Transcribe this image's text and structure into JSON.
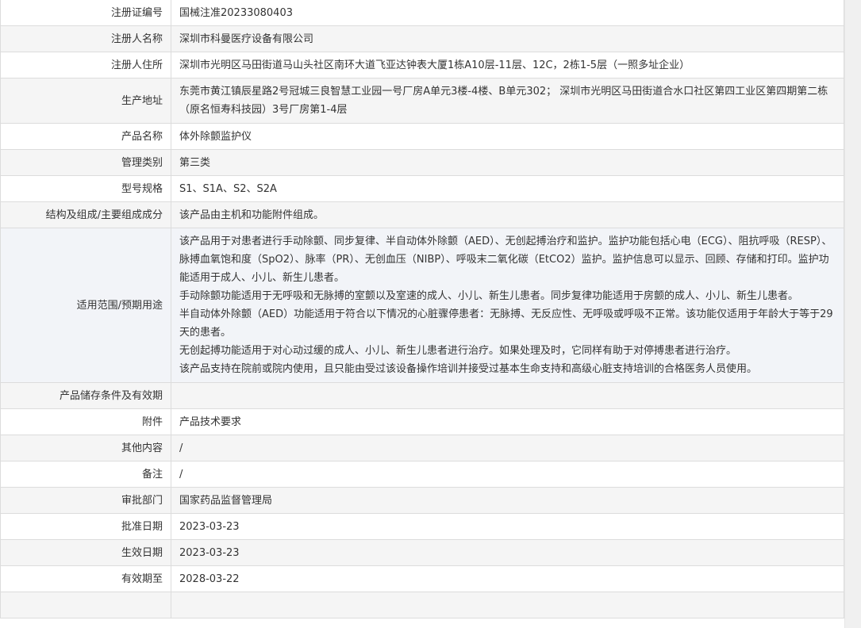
{
  "rows": [
    {
      "label": "注册证编号",
      "value": "国械注准20233080403"
    },
    {
      "label": "注册人名称",
      "value": "深圳市科曼医疗设备有限公司"
    },
    {
      "label": "注册人住所",
      "value": "深圳市光明区马田街道马山头社区南环大道飞亚达钟表大厦1栋A10层-11层、12C，2栋1-5层（一照多址企业）"
    },
    {
      "label": "生产地址",
      "value": "东莞市黄江镇辰星路2号冠城三良智慧工业园一号厂房A单元3楼-4楼、B单元302； 深圳市光明区马田街道合水口社区第四工业区第四期第二栋（原名恒寿科技园）3号厂房第1-4层"
    },
    {
      "label": "产品名称",
      "value": "体外除颤监护仪"
    },
    {
      "label": "管理类别",
      "value": "第三类"
    },
    {
      "label": "型号规格",
      "value": "S1、S1A、S2、S2A"
    },
    {
      "label": "结构及组成/主要组成成分",
      "value": "该产品由主机和功能附件组成。"
    },
    {
      "label": "适用范围/预期用途",
      "lines": [
        "该产品用于对患者进行手动除颤、同步复律、半自动体外除颤（AED）、无创起搏治疗和监护。监护功能包括心电（ECG）、阻抗呼吸（RESP）、脉搏血氧饱和度（SpO2）、脉率（PR）、无创血压（NIBP）、呼吸末二氧化碳（EtCO2）监护。监护信息可以显示、回顾、存储和打印。监护功能适用于成人、小儿、新生儿患者。",
        "手动除颤功能适用于无呼吸和无脉搏的室颤以及室速的成人、小儿、新生儿患者。同步复律功能适用于房颤的成人、小儿、新生儿患者。",
        "半自动体外除颤（AED）功能适用于符合以下情况的心脏骤停患者：无脉搏、无反应性、无呼吸或呼吸不正常。该功能仅适用于年龄大于等于29天的患者。",
        "无创起搏功能适用于对心动过缓的成人、小儿、新生儿患者进行治疗。如果处理及时，它同样有助于对停搏患者进行治疗。",
        "该产品支持在院前或院内使用，且只能由受过该设备操作培训并接受过基本生命支持和高级心脏支持培训的合格医务人员使用。"
      ]
    },
    {
      "label": "产品储存条件及有效期",
      "value": ""
    },
    {
      "label": "附件",
      "value": "产品技术要求"
    },
    {
      "label": "其他内容",
      "value": "/"
    },
    {
      "label": "备注",
      "value": "/"
    },
    {
      "label": "审批部门",
      "value": "国家药品监督管理局"
    },
    {
      "label": "批准日期",
      "value": "2023-03-23"
    },
    {
      "label": "生效日期",
      "value": "2023-03-23"
    },
    {
      "label": "有效期至",
      "value": "2028-03-22"
    }
  ]
}
